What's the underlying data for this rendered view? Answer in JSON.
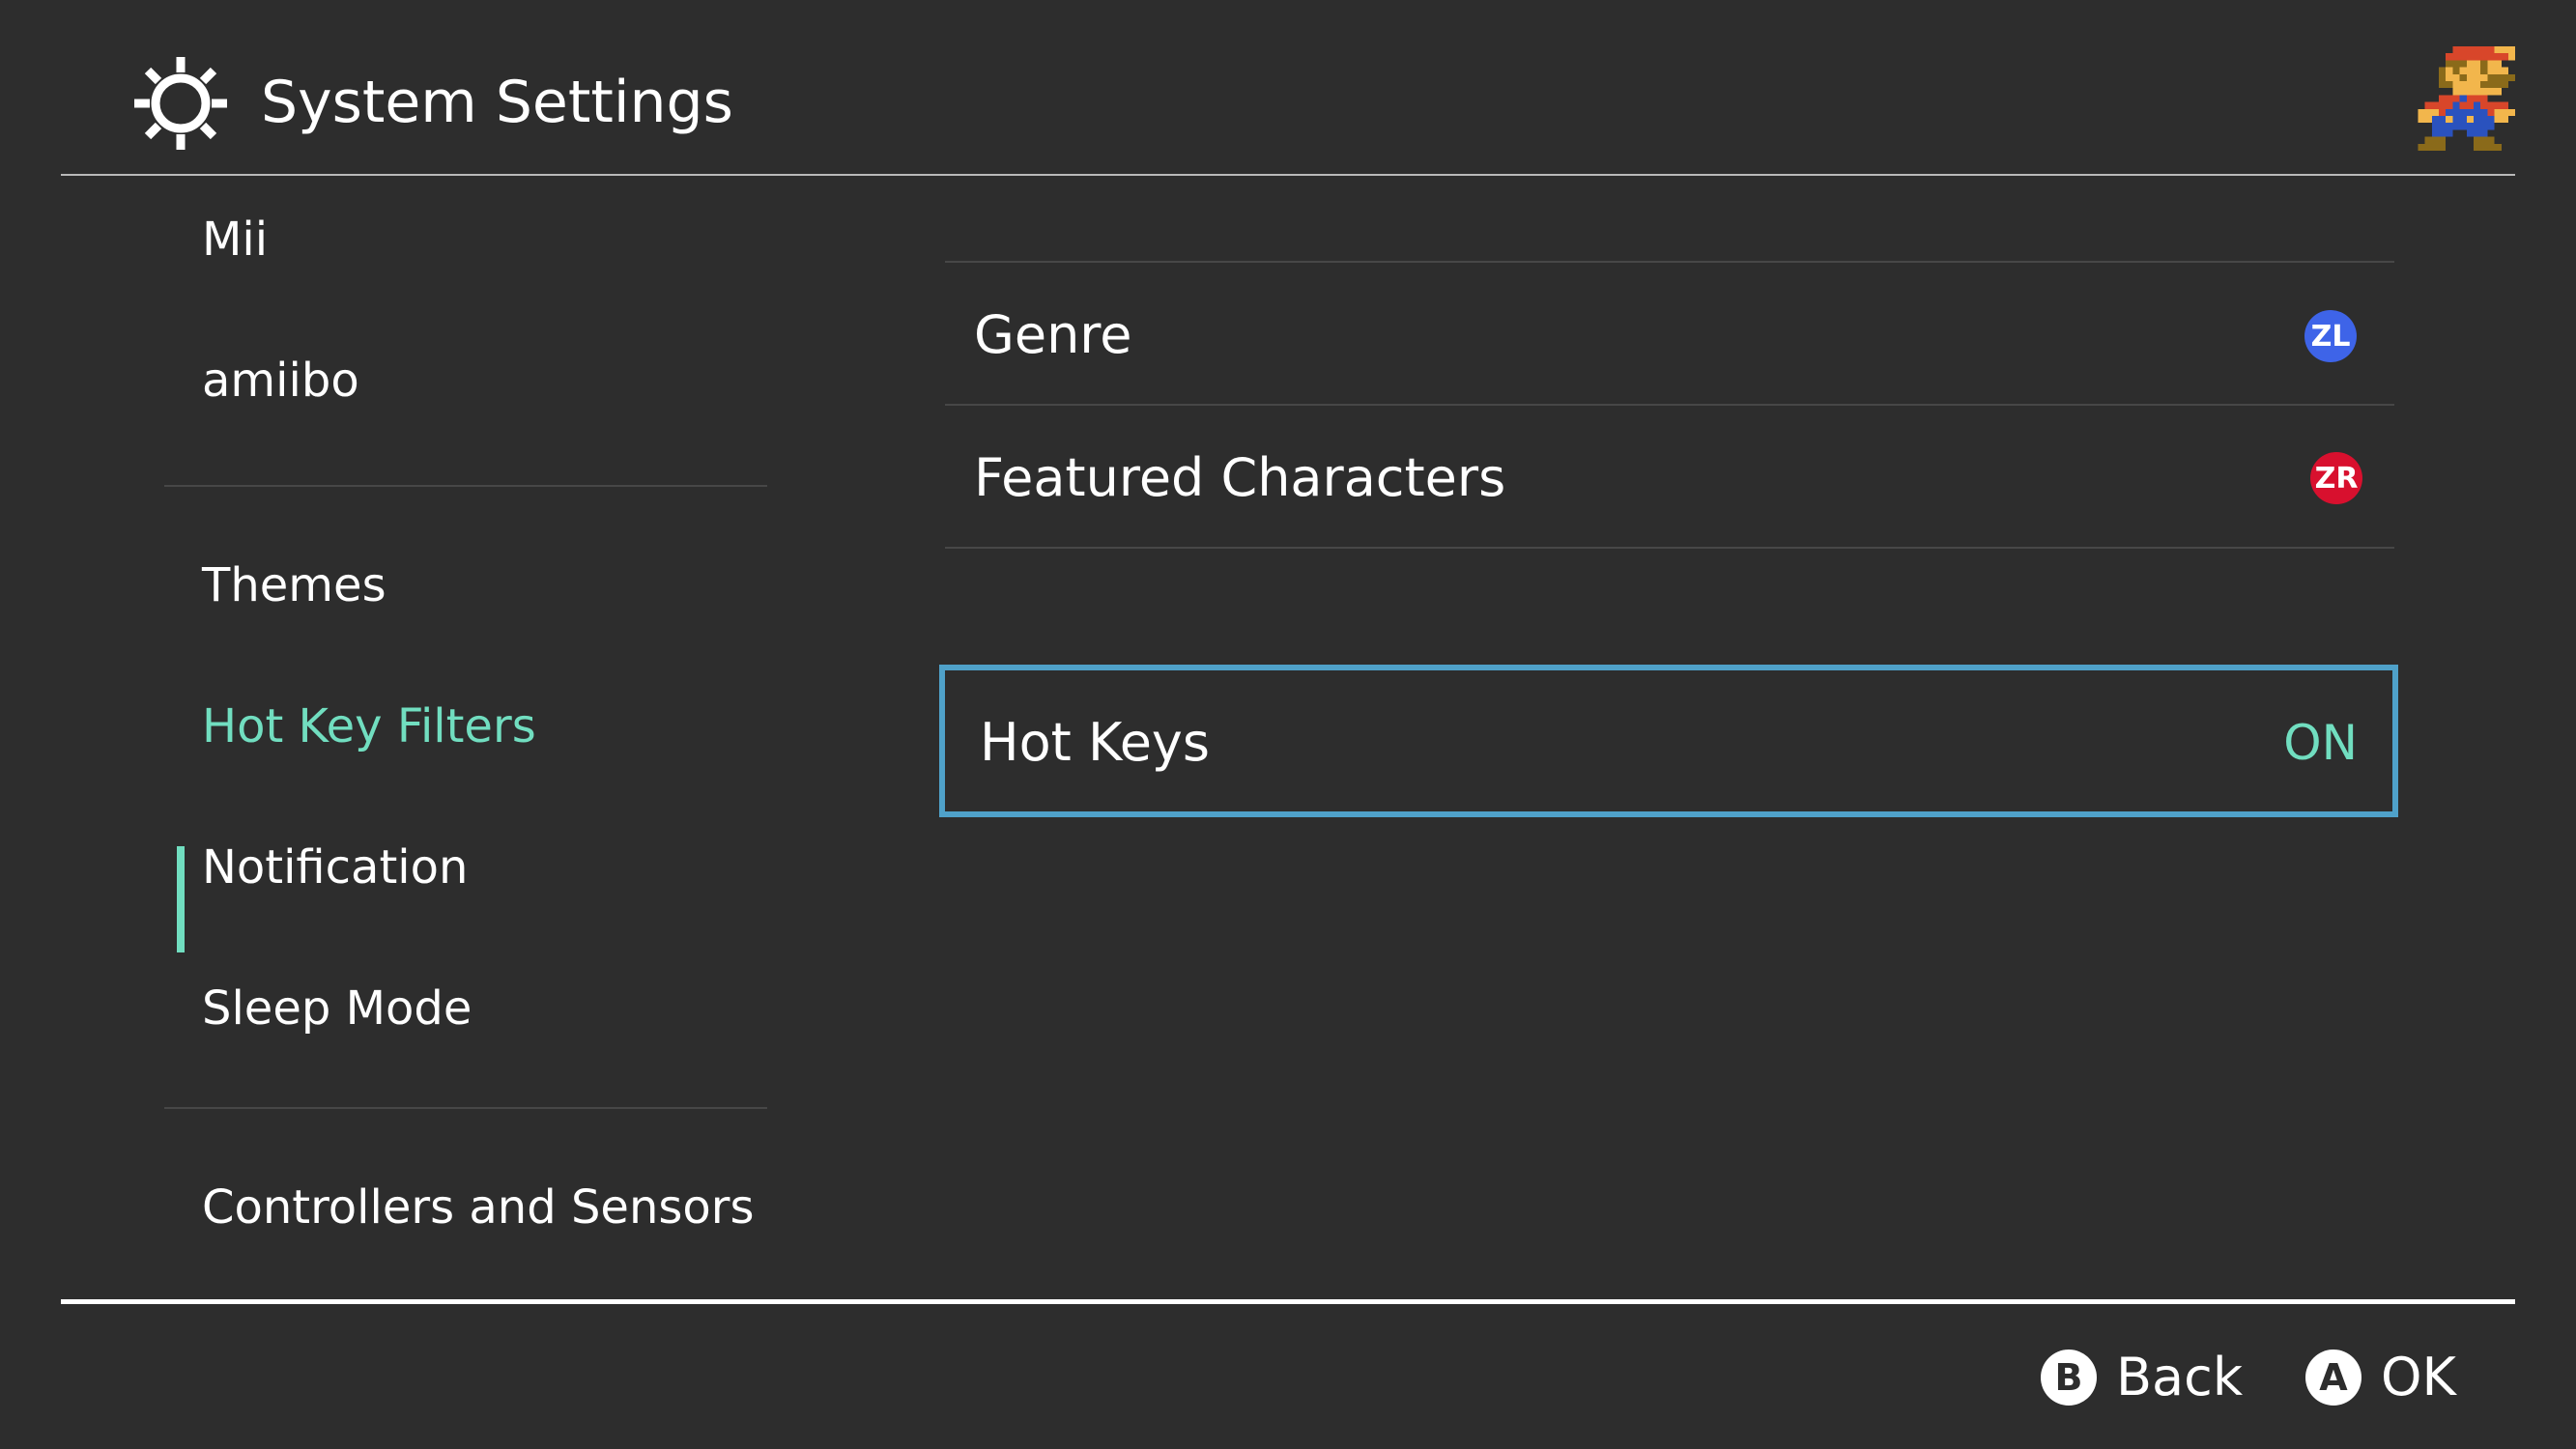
{
  "header": {
    "title": "System Settings",
    "icon": "gear-icon",
    "avatar": "mario-pixel-avatar"
  },
  "sidebar": {
    "items": [
      {
        "label": "Mii"
      },
      {
        "label": "amiibo"
      },
      {
        "label": "Themes"
      },
      {
        "label": "Hot Key Filters",
        "selected": true
      },
      {
        "label": "Notification"
      },
      {
        "label": "Sleep Mode"
      },
      {
        "label": "Controllers and Sensors"
      }
    ]
  },
  "content": {
    "rows": [
      {
        "label": "Genre",
        "button": "ZL",
        "button_color": "#3e64e8"
      },
      {
        "label": "Featured Characters",
        "button": "ZR",
        "button_color": "#d8102e"
      }
    ],
    "hotkeys": {
      "label": "Hot Keys",
      "value": "ON"
    }
  },
  "footer": {
    "back": {
      "button": "B",
      "label": "Back"
    },
    "ok": {
      "button": "A",
      "label": "OK"
    }
  },
  "colors": {
    "background": "#2d2d2d",
    "accent_teal": "#71dec0",
    "focus_border": "#4fa1c9"
  }
}
